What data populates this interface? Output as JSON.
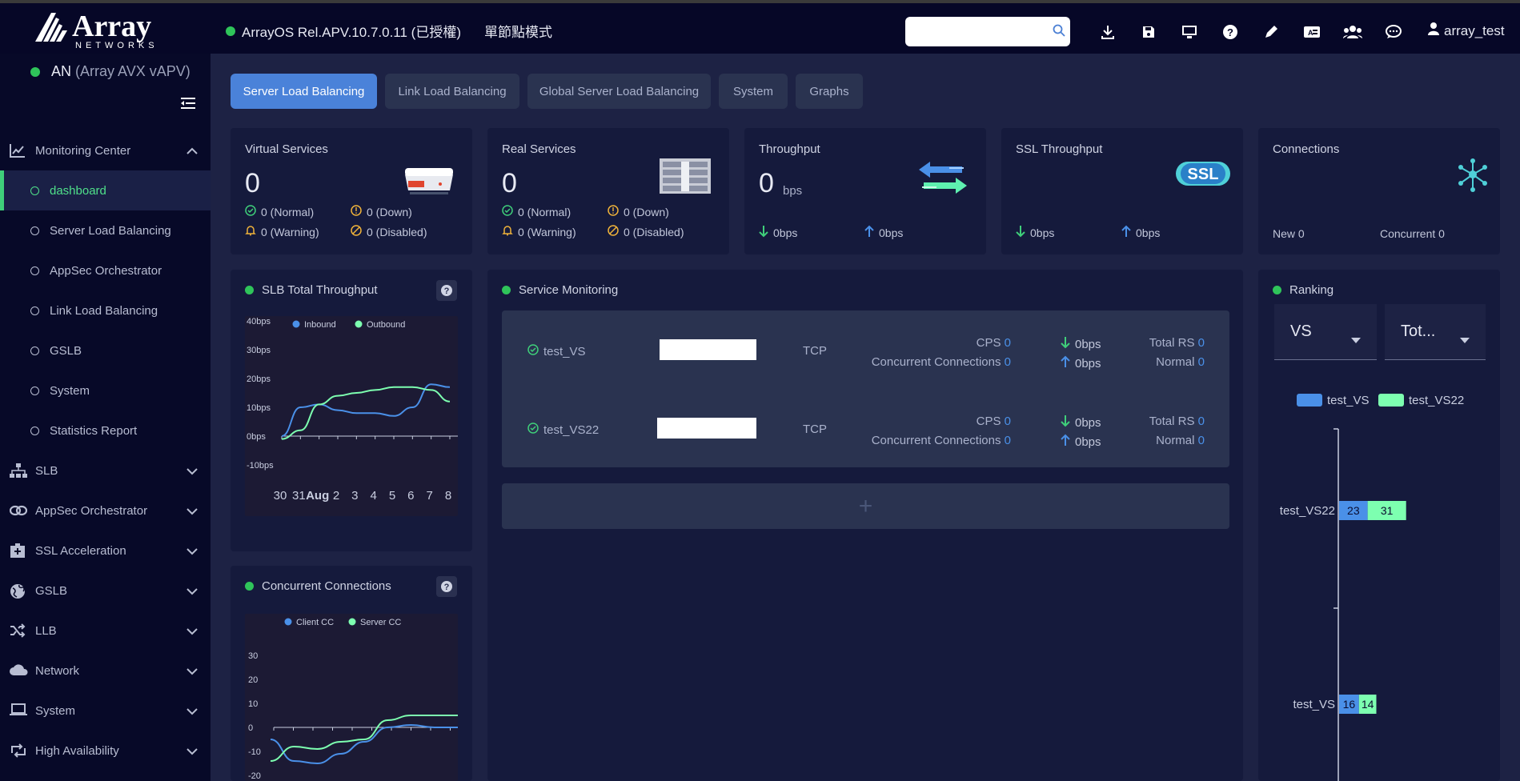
{
  "header": {
    "version": "ArrayOS Rel.APV.10.7.0.11 (已授權)",
    "mode": "單節點模式",
    "search_placeholder": "",
    "user": "array_test"
  },
  "device": {
    "short": "AN",
    "model": "(Array AVX vAPV)"
  },
  "sidebar": {
    "monitoring": "Monitoring Center",
    "subitems": [
      "dashboard",
      "Server Load Balancing",
      "AppSec Orchestrator",
      "Link Load Balancing",
      "GSLB",
      "System",
      "Statistics Report"
    ],
    "items": [
      "SLB",
      "AppSec Orchestrator",
      "SSL Acceleration",
      "GSLB",
      "LLB",
      "Network",
      "System",
      "High Availability"
    ]
  },
  "tabs": [
    "Server Load Balancing",
    "Link Load Balancing",
    "Global Server Load Balancing",
    "System",
    "Graphs"
  ],
  "cards": {
    "vs": {
      "title": "Virtual Services",
      "value": "0",
      "normal": "0 (Normal)",
      "down": "0 (Down)",
      "warning": "0 (Warning)",
      "disabled": "0 (Disabled)"
    },
    "rs": {
      "title": "Real Services",
      "value": "0",
      "normal": "0 (Normal)",
      "down": "0 (Down)",
      "warning": "0 (Warning)",
      "disabled": "0 (Disabled)"
    },
    "tp": {
      "title": "Throughput",
      "value": "0",
      "unit": "bps",
      "in": "0bps",
      "out": "0bps"
    },
    "ssl": {
      "title": "SSL Throughput",
      "badge": "SSL",
      "in": "0bps",
      "out": "0bps"
    },
    "conn": {
      "title": "Connections",
      "new": "New 0",
      "concurrent": "Concurrent 0"
    }
  },
  "slb_chart": {
    "title": "SLB Total Throughput",
    "legend": [
      "Inbound",
      "Outbound"
    ],
    "yticks": [
      "40bps",
      "30bps",
      "20bps",
      "10bps",
      "0bps",
      "-10bps"
    ],
    "xticks": [
      "30",
      "31",
      "Aug",
      "2",
      "3",
      "4",
      "5",
      "6",
      "7",
      "8"
    ]
  },
  "cc_chart": {
    "title": "Concurrent Connections",
    "legend": [
      "Client CC",
      "Server CC"
    ],
    "yticks": [
      "30",
      "20",
      "10",
      "0",
      "-10",
      "-20"
    ]
  },
  "service": {
    "title": "Service Monitoring",
    "labels": {
      "cps": "CPS",
      "cc": "Concurrent Connections",
      "total_rs": "Total RS",
      "normal": "Normal"
    },
    "rows": [
      {
        "name": "test_VS",
        "proto": "TCP",
        "cps": "0",
        "cc": "0",
        "in": "0bps",
        "out": "0bps",
        "total": "0",
        "normal": "0"
      },
      {
        "name": "test_VS22",
        "proto": "TCP",
        "cps": "0",
        "cc": "0",
        "in": "0bps",
        "out": "0bps",
        "total": "0",
        "normal": "0"
      }
    ],
    "add": "+"
  },
  "ranking": {
    "title": "Ranking",
    "dd1": "VS",
    "dd2": "Tot...",
    "legend": [
      "test_VS",
      "test_VS22"
    ],
    "bars": [
      {
        "label": "test_VS22",
        "a": "23",
        "b": "31"
      },
      {
        "label": "test_VS",
        "a": "16",
        "b": "14"
      }
    ]
  },
  "chart_data": [
    {
      "type": "line",
      "title": "SLB Total Throughput",
      "series": [
        {
          "name": "Inbound",
          "values": [
            0,
            10,
            11,
            9,
            8,
            8,
            7,
            10,
            18,
            17
          ]
        },
        {
          "name": "Outbound",
          "values": [
            -1,
            2,
            11,
            14,
            15,
            16,
            17,
            17,
            16,
            12
          ]
        }
      ],
      "categories": [
        "30",
        "31",
        "Aug",
        "2",
        "3",
        "4",
        "5",
        "6",
        "7",
        "8"
      ],
      "ylim": [
        -10,
        40
      ]
    },
    {
      "type": "line",
      "title": "Concurrent Connections",
      "series": [
        {
          "name": "Client CC",
          "values": [
            -5,
            -14,
            -15,
            -11,
            -6,
            0,
            1,
            0,
            0
          ]
        },
        {
          "name": "Server CC",
          "values": [
            -14,
            -8,
            -9,
            -6,
            -5,
            3,
            5,
            5,
            5
          ]
        }
      ],
      "ylim": [
        -20,
        30
      ]
    },
    {
      "type": "bar",
      "title": "Ranking",
      "categories": [
        "test_VS22",
        "test_VS"
      ],
      "series": [
        {
          "name": "test_VS",
          "values": [
            23,
            16
          ]
        },
        {
          "name": "test_VS22",
          "values": [
            31,
            14
          ]
        }
      ]
    }
  ],
  "colors": {
    "accent": "#4a82d9",
    "green": "#2fc45a",
    "series_a": "#4a90e8",
    "series_b": "#7dffb0"
  }
}
